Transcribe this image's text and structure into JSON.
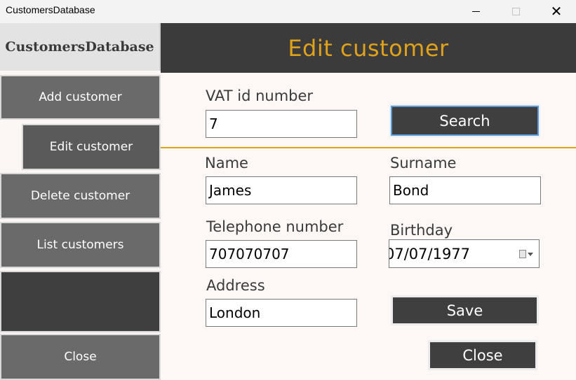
{
  "window": {
    "title": "CustomersDatabase",
    "minimize_icon": "minimize-icon",
    "maximize_icon": "maximize-icon",
    "close_glyph": "✕"
  },
  "sidebar": {
    "brand": "CustomersDatabase",
    "items": [
      {
        "label": "Add customer"
      },
      {
        "label": "Edit customer"
      },
      {
        "label": "Delete customer"
      },
      {
        "label": "List customers"
      },
      {
        "label": "Close"
      }
    ]
  },
  "header": {
    "title": "Edit customer"
  },
  "form": {
    "vat_label": "VAT id number",
    "vat_value": "7",
    "search_label": "Search",
    "name_label": "Name",
    "name_value": "James",
    "surname_label": "Surname",
    "surname_value": "Bond",
    "telephone_label": "Telephone number",
    "telephone_value": "707070707",
    "birthday_label": "Birthday",
    "birthday_value": "07/07/1977",
    "address_label": "Address",
    "address_value": "London",
    "save_label": "Save",
    "close_label": "Close"
  },
  "colors": {
    "accent": "#e0a21a",
    "dark": "#3b3b3b",
    "nav": "#6a6a6a"
  }
}
